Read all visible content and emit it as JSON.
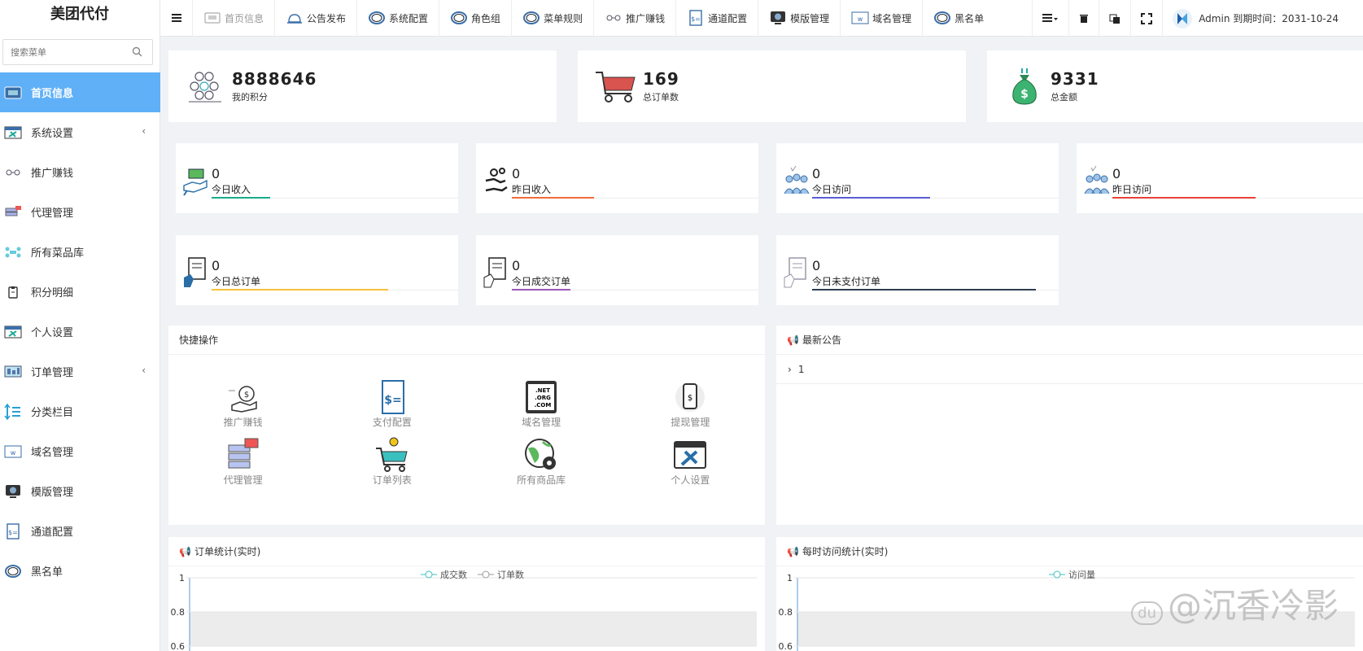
{
  "brand": "美团代付",
  "search": {
    "placeholder": "搜索菜单"
  },
  "sidebar": {
    "items": [
      {
        "label": "首页信息",
        "icon": "home-screen-icon",
        "active": true
      },
      {
        "label": "系统设置",
        "icon": "tools-icon",
        "arrow": "‹"
      },
      {
        "label": "推广赚钱",
        "icon": "glasses-icon"
      },
      {
        "label": "代理管理",
        "icon": "cart-server-icon"
      },
      {
        "label": "所有菜品库",
        "icon": "network-icon"
      },
      {
        "label": "积分明细",
        "icon": "clipboard-icon"
      },
      {
        "label": "个人设置",
        "icon": "tools-icon"
      },
      {
        "label": "订单管理",
        "icon": "monitor-icon",
        "arrow": "‹"
      },
      {
        "label": "分类栏目",
        "icon": "sort-icon"
      },
      {
        "label": "域名管理",
        "icon": "www-icon"
      },
      {
        "label": "模版管理",
        "icon": "template-icon"
      },
      {
        "label": "通道配置",
        "icon": "bill-icon"
      },
      {
        "label": "黑名单",
        "icon": "ring-icon"
      }
    ]
  },
  "topbar": {
    "items": [
      {
        "label": "首页信息",
        "icon": "home-screen-icon"
      },
      {
        "label": "公告发布",
        "icon": "bell-icon"
      },
      {
        "label": "系统配置",
        "icon": "ring-icon"
      },
      {
        "label": "角色组",
        "icon": "ring-icon"
      },
      {
        "label": "菜单规则",
        "icon": "ring-icon"
      },
      {
        "label": "推广赚钱",
        "icon": "glasses-icon"
      },
      {
        "label": "通道配置",
        "icon": "bill-icon"
      },
      {
        "label": "模版管理",
        "icon": "template-icon"
      },
      {
        "label": "域名管理",
        "icon": "www-icon"
      },
      {
        "label": "黑名单",
        "icon": "ring-icon"
      }
    ],
    "user_text": "Admin 到期时间：2031-10-24"
  },
  "summary": [
    {
      "value": "8888646",
      "label": "我的积分",
      "icon": "points-icon"
    },
    {
      "value": "169",
      "label": "总订单数",
      "icon": "cart-icon"
    },
    {
      "value": "9331",
      "label": "总金额",
      "icon": "money-bag-icon"
    }
  ],
  "stats": [
    {
      "value": "0",
      "label": "今日收入",
      "color": "#1aab8a",
      "fill": 0.25,
      "icon": "hand-money-icon"
    },
    {
      "value": "0",
      "label": "昨日收入",
      "color": "#f26b3a",
      "fill": 0.35,
      "icon": "hand-coin-icon"
    },
    {
      "value": "0",
      "label": "今日访问",
      "color": "#5b5bd6",
      "fill": 0.5,
      "icon": "people-icon"
    },
    {
      "value": "0",
      "label": "昨日访问",
      "color": "#e8413a",
      "fill": 0.6,
      "icon": "people-icon"
    },
    {
      "value": "0",
      "label": "今日总订单",
      "color": "#f8c23d",
      "fill": 0.75,
      "icon": "order-doc-icon"
    },
    {
      "value": "0",
      "label": "今日成交订单",
      "color": "#9b59b6",
      "fill": 0.25,
      "icon": "order-doc-icon"
    },
    {
      "value": "0",
      "label": "今日未支付订单",
      "color": "#2c3e50",
      "fill": 0.95,
      "icon": "order-doc-icon"
    }
  ],
  "quick": {
    "title": "快捷操作",
    "items": [
      {
        "label": "推广赚钱",
        "icon": "money-hand-icon"
      },
      {
        "label": "支付配置",
        "icon": "bill-icon"
      },
      {
        "label": "域名管理",
        "icon": "dns-icon"
      },
      {
        "label": "提现管理",
        "icon": "phone-money-icon"
      },
      {
        "label": "代理管理",
        "icon": "server-icon"
      },
      {
        "label": "订单列表",
        "icon": "cart-icon"
      },
      {
        "label": "所有商品库",
        "icon": "globe-gear-icon"
      },
      {
        "label": "个人设置",
        "icon": "tools-window-icon"
      }
    ]
  },
  "notice": {
    "title": "最新公告",
    "item": "1"
  },
  "chart_data": [
    {
      "type": "line",
      "title": "订单统计(实时)",
      "series": [
        {
          "name": "成交数",
          "values": []
        },
        {
          "name": "订单数",
          "values": []
        }
      ],
      "y_ticks": [
        "1",
        "0.8",
        "0.6"
      ],
      "ylim": [
        0.6,
        1
      ]
    },
    {
      "type": "line",
      "title": "每时访问统计(实时)",
      "series": [
        {
          "name": "访问量",
          "values": []
        }
      ],
      "y_ticks": [
        "1",
        "0.8",
        "0.6"
      ],
      "ylim": [
        0.6,
        1
      ]
    }
  ],
  "watermark": {
    "logo": "du",
    "text": "@沉香冷影"
  },
  "colors": {
    "accent": "#5fb0f7"
  }
}
